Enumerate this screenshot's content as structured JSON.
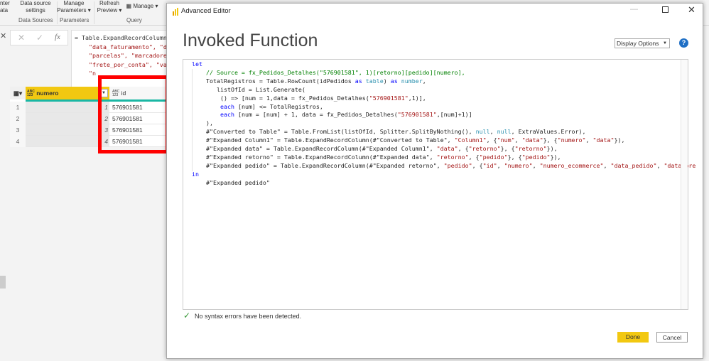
{
  "ribbon": {
    "items": [
      {
        "label": "nter\nata"
      },
      {
        "label": "Data source\nsettings"
      },
      {
        "label": "Manage\nParameters ▾"
      },
      {
        "label": "Refresh\nPreview ▾"
      },
      {
        "label": "Manage ▾"
      }
    ],
    "groups": [
      "Data Sources",
      "Parameters",
      "Query"
    ]
  },
  "formula": {
    "lines": [
      "= Table.ExpandRecordColumn",
      "    \"data_faturamento\", \"d",
      "    \"parcelas\", \"marcadore",
      "    \"frete_por_conta\", \"va",
      "    \"n"
    ]
  },
  "grid": {
    "columns": [
      {
        "type": "ABC\n123",
        "name": "numero"
      },
      {
        "type": "ABC\n123",
        "name": "id"
      }
    ],
    "rows": [
      {
        "n": "1",
        "idx": "1",
        "id": "576901581"
      },
      {
        "n": "2",
        "idx": "2",
        "id": "576901581"
      },
      {
        "n": "3",
        "idx": "3",
        "id": "576901581"
      },
      {
        "n": "4",
        "idx": "4",
        "id": "576901581"
      }
    ]
  },
  "dialog": {
    "title": "Advanced Editor",
    "heading": "Invoked Function",
    "display_options": "Display Options",
    "status": "No syntax errors have been detected.",
    "done": "Done",
    "cancel": "Cancel"
  },
  "colors": {
    "accent": "#f2c811",
    "highlight": "#ff0000",
    "keyword": "#0000ff",
    "string": "#a31515",
    "comment": "#008000"
  },
  "code": [
    [
      [
        "kw",
        "let"
      ]
    ],
    [
      [
        "cm",
        "    // Source = fx_Pedidos_Detalhes(\"576901581\", 1)[retorno][pedido][numero],"
      ]
    ],
    [
      [
        "t",
        "    TotalRegistros = Table.RowCount(idPedidos "
      ],
      [
        "kw",
        "as"
      ],
      [
        "t",
        " "
      ],
      [
        "ty",
        "table"
      ],
      [
        "t",
        ") "
      ],
      [
        "kw",
        "as"
      ],
      [
        "t",
        " "
      ],
      [
        "ty",
        "number"
      ],
      [
        "t",
        ","
      ]
    ],
    [
      [
        "t",
        "       listOfId = List.Generate("
      ]
    ],
    [
      [
        "t",
        "        () => [num = 1,data = fx_Pedidos_Detalhes("
      ],
      [
        "str",
        "\"576901581\""
      ],
      [
        "t",
        ",1)],"
      ]
    ],
    [
      [
        "kw",
        "        each"
      ],
      [
        "t",
        " [num] <= TotalRegistros,"
      ]
    ],
    [
      [
        "kw",
        "        each"
      ],
      [
        "t",
        " [num = [num] + 1, data = fx_Pedidos_Detalhes("
      ],
      [
        "str",
        "\"576901581\""
      ],
      [
        "t",
        ",[num]+1)]"
      ]
    ],
    [
      [
        "t",
        "    ),"
      ]
    ],
    [
      [
        "t",
        "    #\"Converted to Table\" = Table.FromList(listOfId, Splitter.SplitByNothing(), "
      ],
      [
        "ty",
        "null"
      ],
      [
        "t",
        ", "
      ],
      [
        "ty",
        "null"
      ],
      [
        "t",
        ", ExtraValues.Error),"
      ]
    ],
    [
      [
        "t",
        "    #\"Expanded Column1\" = Table.ExpandRecordColumn(#\"Converted to Table\", "
      ],
      [
        "str",
        "\"Column1\""
      ],
      [
        "t",
        ", {"
      ],
      [
        "str",
        "\"num\""
      ],
      [
        "t",
        ", "
      ],
      [
        "str",
        "\"data\""
      ],
      [
        "t",
        "}, {"
      ],
      [
        "str",
        "\"numero\""
      ],
      [
        "t",
        ", "
      ],
      [
        "str",
        "\"data\""
      ],
      [
        "t",
        "}),"
      ]
    ],
    [
      [
        "t",
        "    #\"Expanded data\" = Table.ExpandRecordColumn(#\"Expanded Column1\", "
      ],
      [
        "str",
        "\"data\""
      ],
      [
        "t",
        ", {"
      ],
      [
        "str",
        "\"retorno\""
      ],
      [
        "t",
        "}, {"
      ],
      [
        "str",
        "\"retorno\""
      ],
      [
        "t",
        "}),"
      ]
    ],
    [
      [
        "t",
        "    #\"Expanded retorno\" = Table.ExpandRecordColumn(#\"Expanded data\", "
      ],
      [
        "str",
        "\"retorno\""
      ],
      [
        "t",
        ", {"
      ],
      [
        "str",
        "\"pedido\""
      ],
      [
        "t",
        "}, {"
      ],
      [
        "str",
        "\"pedido\""
      ],
      [
        "t",
        "}),"
      ]
    ],
    [
      [
        "t",
        "    #\"Expanded pedido\" = Table.ExpandRecordColumn(#\"Expanded retorno\", "
      ],
      [
        "str",
        "\"pedido\""
      ],
      [
        "t",
        ", {"
      ],
      [
        "str",
        "\"id\""
      ],
      [
        "t",
        ", "
      ],
      [
        "str",
        "\"numero\""
      ],
      [
        "t",
        ", "
      ],
      [
        "str",
        "\"numero_ecommerce\""
      ],
      [
        "t",
        ", "
      ],
      [
        "str",
        "\"data_pedido\""
      ],
      [
        "t",
        ", "
      ],
      [
        "str",
        "\"data_pre"
      ]
    ],
    [
      [
        "kw",
        "in"
      ]
    ],
    [
      [
        "t",
        "    #\"Expanded pedido\""
      ]
    ]
  ]
}
